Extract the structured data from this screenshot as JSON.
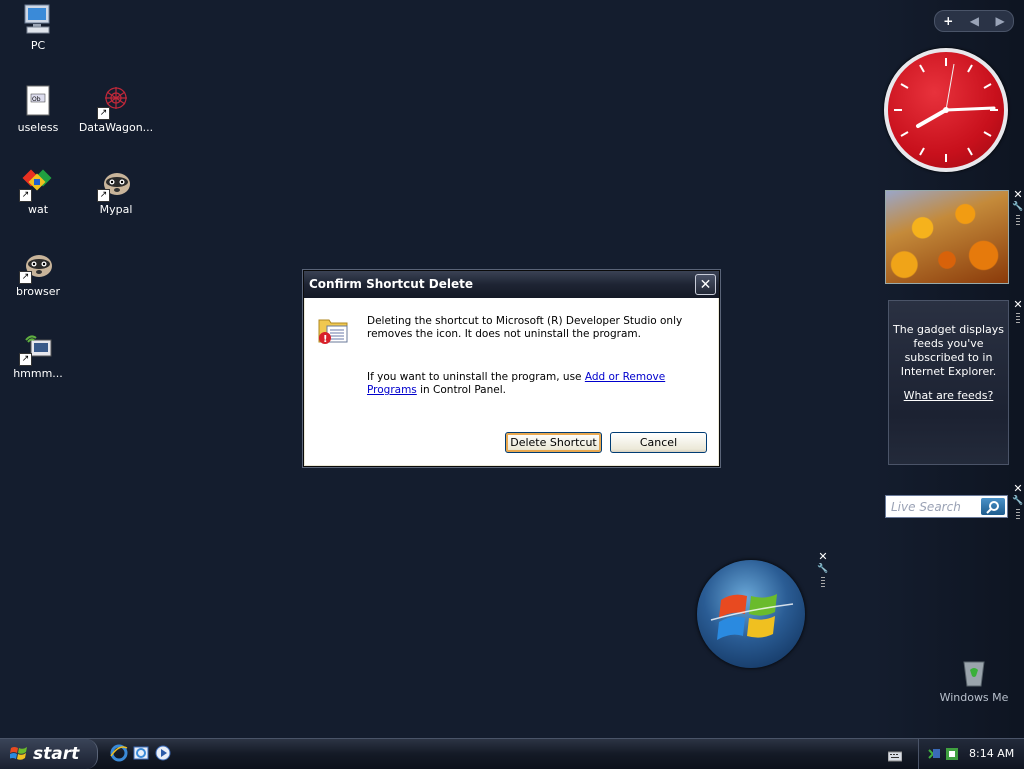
{
  "desktop": {
    "icons": [
      {
        "label": "PC"
      },
      {
        "label": "useless"
      },
      {
        "label": "DataWagon..."
      },
      {
        "label": "wat"
      },
      {
        "label": "Mypal"
      },
      {
        "label": "browser"
      },
      {
        "label": "hmmm..."
      }
    ],
    "recycle_bin_label": "Windows Me"
  },
  "sidebar": {
    "feeds_message": "The gadget displays feeds you've subscribed to in Internet Explorer.",
    "feeds_link": "What are feeds?",
    "search_placeholder": "Live Search",
    "clock_time": "8:14"
  },
  "dialog": {
    "title": "Confirm Shortcut Delete",
    "message_line1": "Deleting the shortcut to Microsoft (R) Developer Studio only removes the icon. It does not uninstall the program.",
    "message2_prefix": "If you want to uninstall the program, use ",
    "message2_link": "Add or Remove Programs",
    "message2_suffix": " in Control Panel.",
    "delete_button": "Delete Shortcut",
    "cancel_button": "Cancel"
  },
  "taskbar": {
    "start_label": "start",
    "clock": "8:14 AM"
  }
}
